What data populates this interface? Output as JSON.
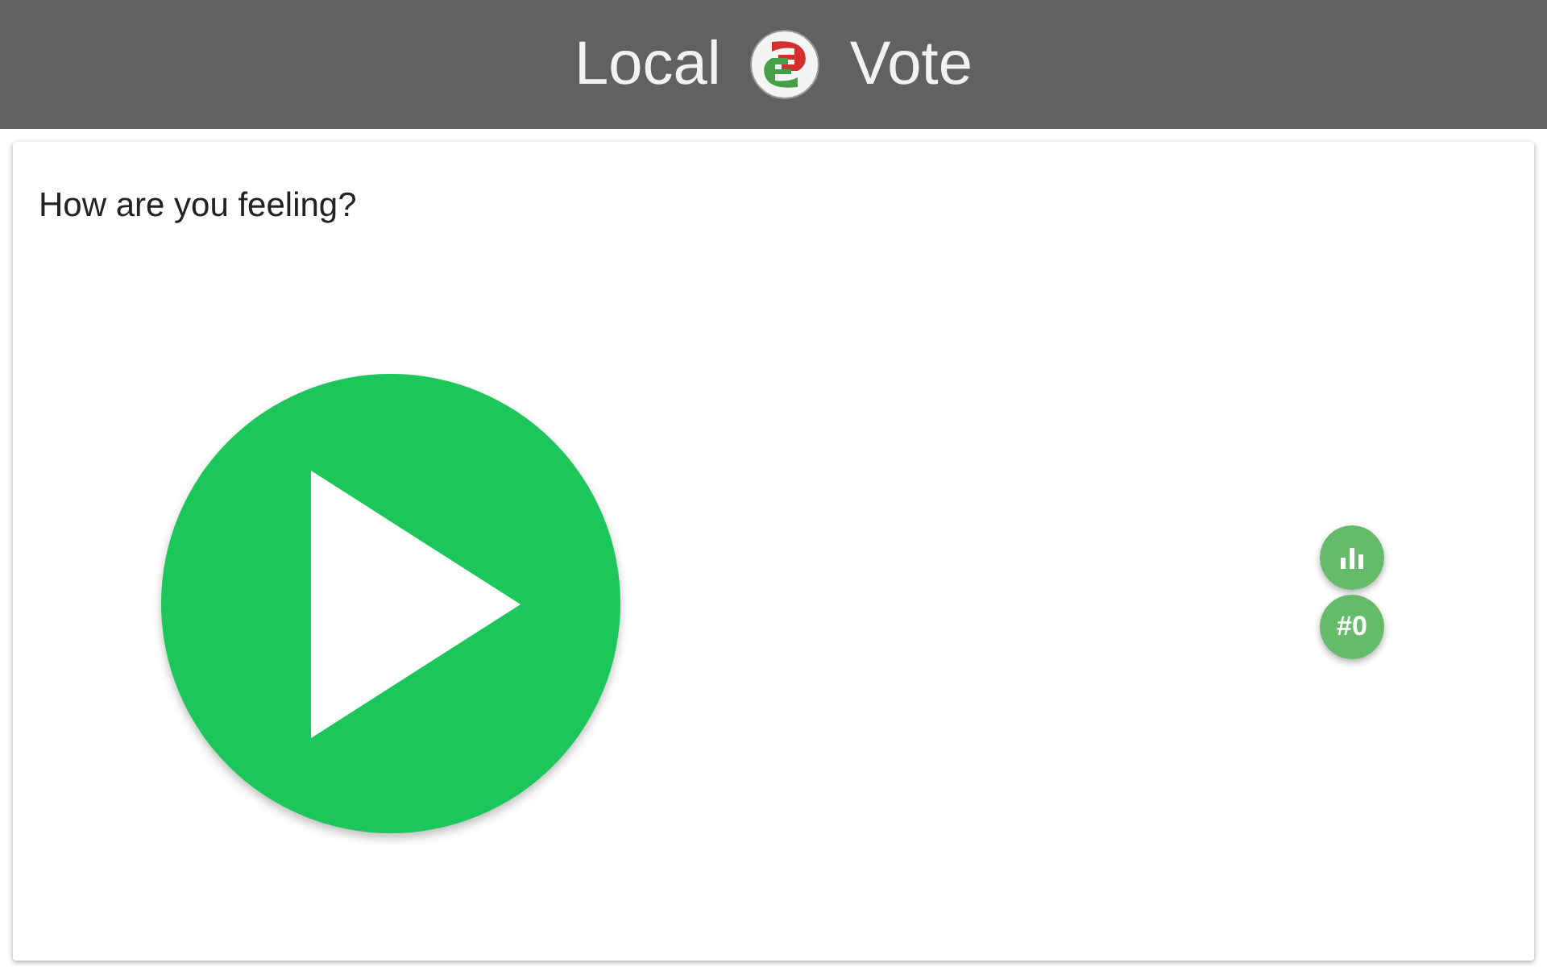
{
  "header": {
    "title_left": "Local",
    "title_right": "Vote"
  },
  "question": "How are you feeling?",
  "counter": "#0"
}
